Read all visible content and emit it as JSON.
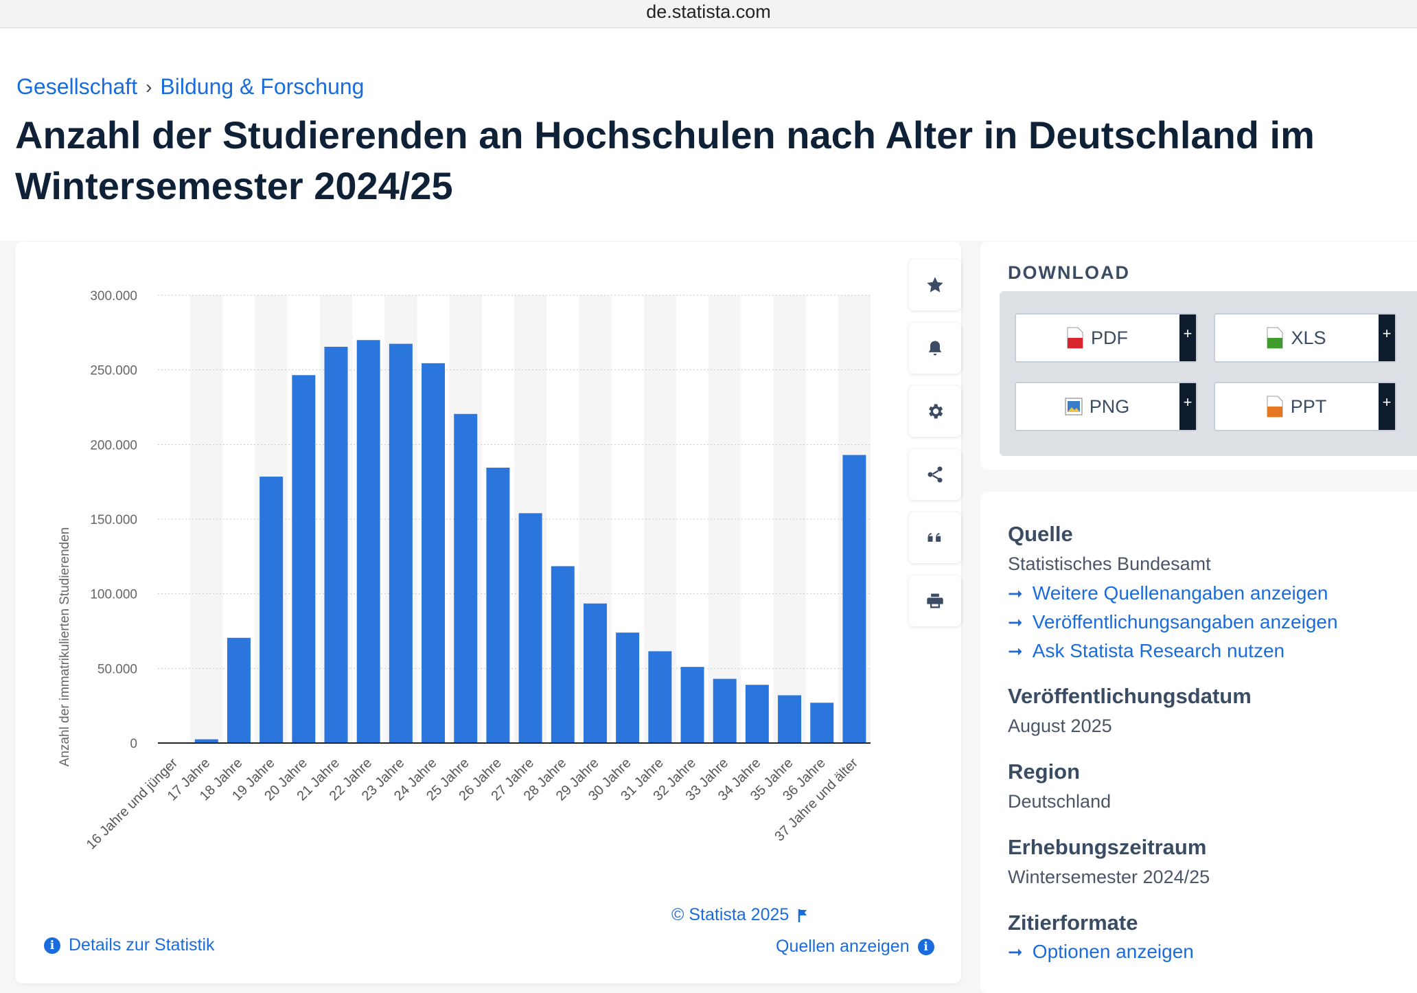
{
  "browser": {
    "url": "de.statista.com"
  },
  "breadcrumb": {
    "items": [
      "Gesellschaft",
      "Bildung & Forschung"
    ],
    "separator": "›"
  },
  "page": {
    "title": "Anzahl der Studierenden an Hochschulen nach Alter in Deutschland im Wintersemester 2024/25"
  },
  "chart_data": {
    "type": "bar",
    "ylabel": "Anzahl der immatrikulierten Studierenden",
    "ylim": [
      0,
      300000
    ],
    "yticks": [
      0,
      50000,
      100000,
      150000,
      200000,
      250000,
      300000
    ],
    "ytick_labels": [
      "0",
      "50.000",
      "100.000",
      "150.000",
      "200.000",
      "250.000",
      "300.000"
    ],
    "categories": [
      "16 Jahre und jünger",
      "17 Jahre",
      "18 Jahre",
      "19 Jahre",
      "20 Jahre",
      "21 Jahre",
      "22 Jahre",
      "23 Jahre",
      "24 Jahre",
      "25 Jahre",
      "26 Jahre",
      "27 Jahre",
      "28 Jahre",
      "29 Jahre",
      "30 Jahre",
      "31 Jahre",
      "32 Jahre",
      "33 Jahre",
      "34 Jahre",
      "35 Jahre",
      "36 Jahre",
      "37 Jahre und älter"
    ],
    "values": [
      300,
      2500,
      70500,
      178500,
      246500,
      265500,
      270000,
      267500,
      254500,
      220500,
      184500,
      154000,
      118500,
      93500,
      74000,
      61500,
      51000,
      43000,
      39000,
      32000,
      27000,
      193000
    ],
    "bar_color": "#2a76dd",
    "grid": true
  },
  "chart_footer": {
    "copyright": "© Statista 2025",
    "details_link": "Details zur Statistik",
    "sources_link": "Quellen anzeigen"
  },
  "tools": [
    "star-icon",
    "bell-icon",
    "gear-icon",
    "share-icon",
    "quote-icon",
    "print-icon"
  ],
  "download": {
    "title": "DOWNLOAD",
    "buttons": [
      {
        "label": "PDF",
        "icon_color": "#d9262c"
      },
      {
        "label": "XLS",
        "icon_color": "#3f9b2e"
      },
      {
        "label": "PNG",
        "icon_color": "#3b7cc9"
      },
      {
        "label": "PPT",
        "icon_color": "#e67722"
      }
    ],
    "plus": "+"
  },
  "meta": {
    "source_heading": "Quelle",
    "source_value": "Statistisches Bundesamt",
    "links": [
      "Weitere Quellenangaben anzeigen",
      "Veröffentlichungsangaben anzeigen",
      "Ask Statista Research nutzen"
    ],
    "pubdate_heading": "Veröffentlichungsdatum",
    "pubdate_value": "August 2025",
    "region_heading": "Region",
    "region_value": "Deutschland",
    "period_heading": "Erhebungszeitraum",
    "period_value": "Wintersemester 2024/25",
    "cite_heading": "Zitierformate",
    "cite_link": "Optionen anzeigen"
  }
}
